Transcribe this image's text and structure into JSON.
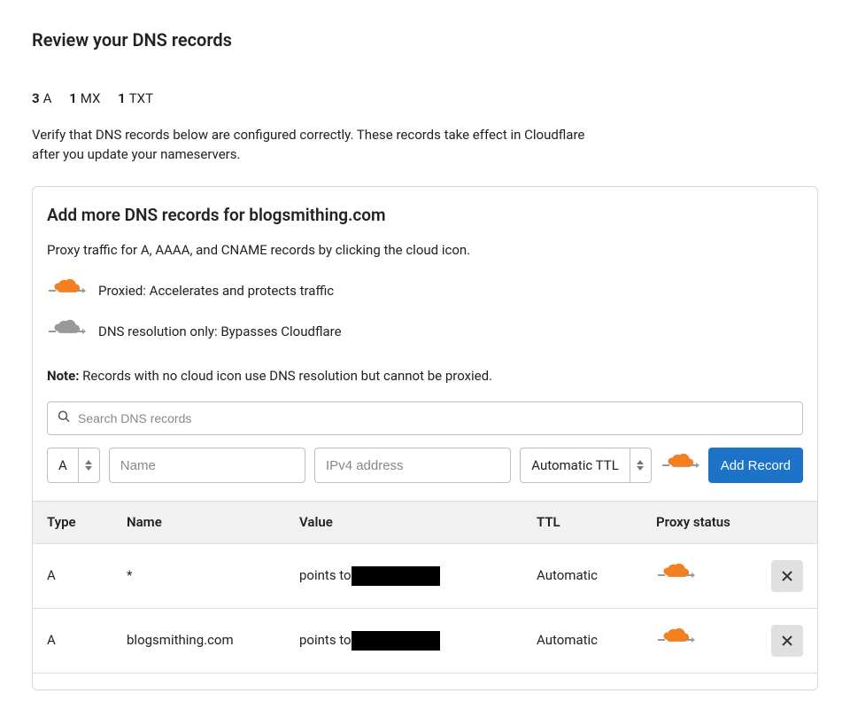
{
  "page_title": "Review your DNS records",
  "record_counts": [
    {
      "count": "3",
      "label": "A"
    },
    {
      "count": "1",
      "label": "MX"
    },
    {
      "count": "1",
      "label": "TXT"
    }
  ],
  "description": "Verify that DNS records below are configured correctly. These records take effect in Cloudflare after you update your nameservers.",
  "card": {
    "title": "Add more DNS records for blogsmithing.com",
    "subtext": "Proxy traffic for A, AAAA, and CNAME records by clicking the cloud icon.",
    "legend_proxied": "Proxied: Accelerates and protects traffic",
    "legend_dns_only": "DNS resolution only: Bypasses Cloudflare",
    "note_label": "Note:",
    "note_text": " Records with no cloud icon use DNS resolution but cannot be proxied."
  },
  "search": {
    "placeholder": "Search DNS records"
  },
  "add_form": {
    "type_value": "A",
    "name_placeholder": "Name",
    "ip_placeholder": "IPv4 address",
    "ttl_value": "Automatic TTL",
    "add_label": "Add Record"
  },
  "table": {
    "headers": {
      "type": "Type",
      "name": "Name",
      "value": "Value",
      "ttl": "TTL",
      "proxy": "Proxy status"
    },
    "rows": [
      {
        "type": "A",
        "name": "*",
        "value_prefix": "points to",
        "ttl": "Automatic",
        "proxied": true
      },
      {
        "type": "A",
        "name": "blogsmithing.com",
        "value_prefix": "points to",
        "ttl": "Automatic",
        "proxied": true
      }
    ]
  }
}
